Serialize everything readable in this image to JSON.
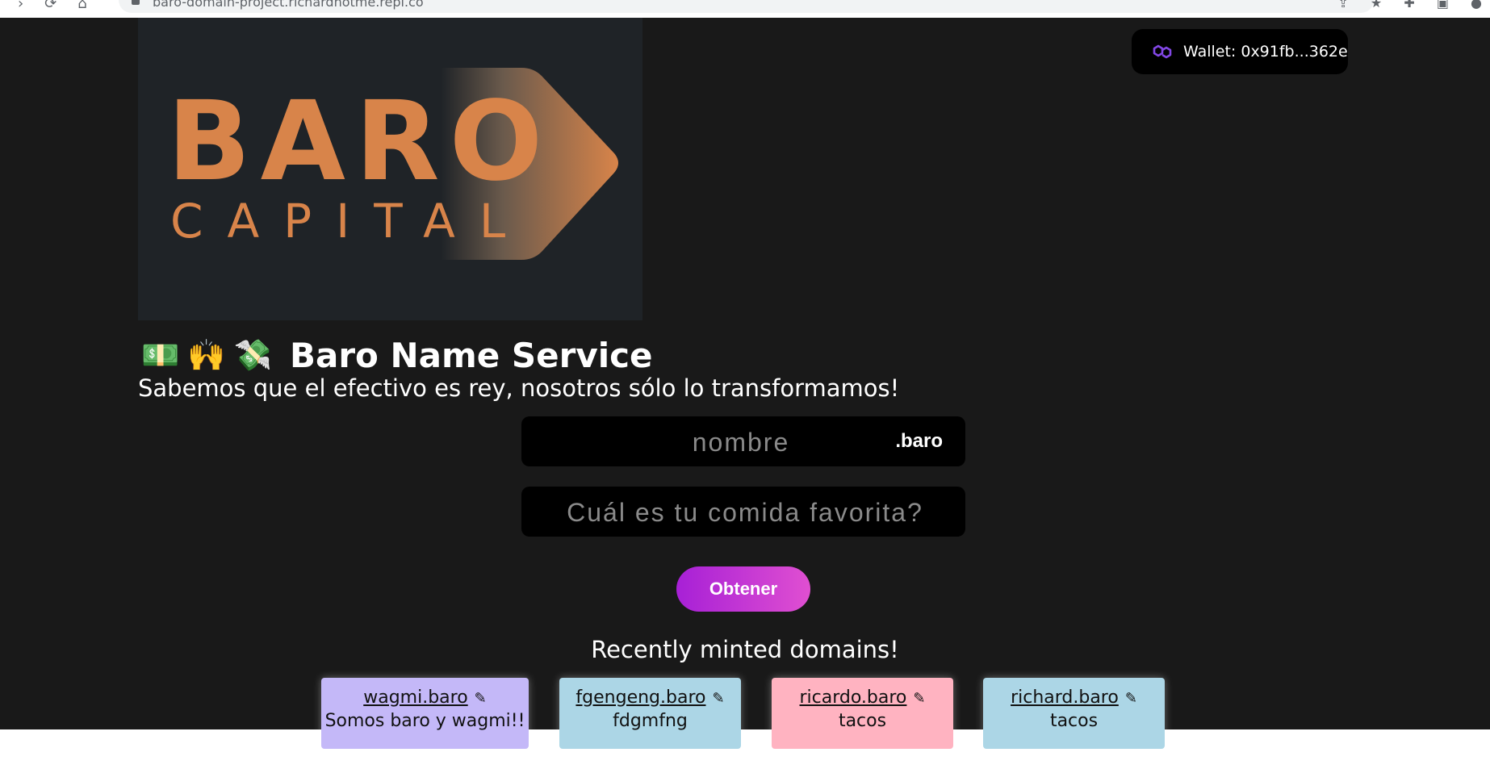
{
  "browser": {
    "url": "baro-domain-project.richardnotme.repl.co"
  },
  "wallet": {
    "label": "Wallet: 0x91fb...362e",
    "icon": "polygon-icon"
  },
  "logo": {
    "line1": "BARO",
    "line2": "CAPITAL"
  },
  "header": {
    "emojis": [
      "💵",
      "🙌",
      "💸"
    ],
    "title": "Baro Name Service",
    "subtitle": "Sabemos que el efectivo es rey, nosotros sólo lo transformamos!"
  },
  "form": {
    "name_placeholder": "nombre",
    "name_value": "",
    "tld": ".baro",
    "record_placeholder": "Cuál es tu comida favorita?",
    "record_value": "",
    "mint_label": "Obtener"
  },
  "recent": {
    "heading": "Recently minted domains!",
    "domains": [
      {
        "name": "wagmi.baro",
        "record": "Somos baro y wagmi!!",
        "color": "#c4b8f8"
      },
      {
        "name": "fgengeng.baro",
        "record": "fdgmfng",
        "color": "#acd6e6"
      },
      {
        "name": "ricardo.baro",
        "record": "tacos",
        "color": "#ffb3c1"
      },
      {
        "name": "richard.baro",
        "record": "tacos",
        "color": "#acd6e6"
      }
    ]
  },
  "colors": {
    "background": "#191919",
    "logo_orange": "#d8844a",
    "mint_gradient_start": "#a720d6",
    "mint_gradient_end": "#e04fd1"
  }
}
